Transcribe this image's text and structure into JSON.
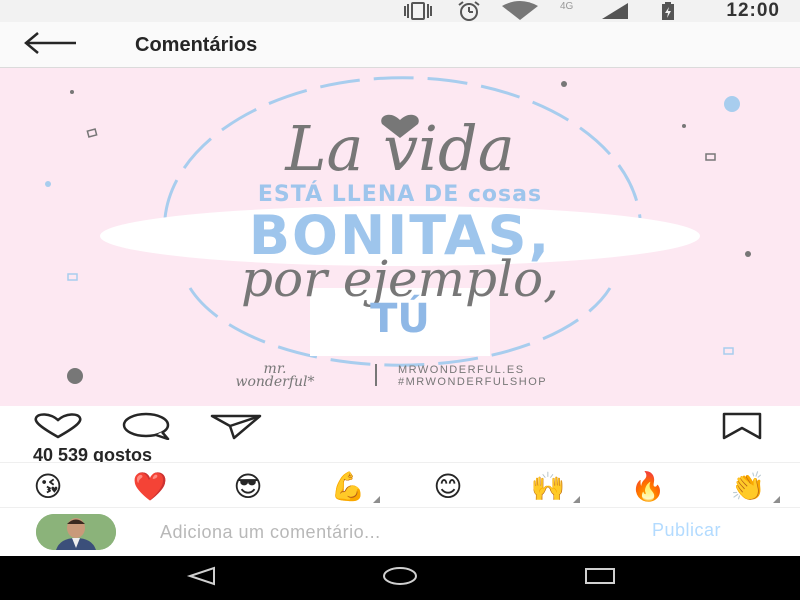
{
  "status_bar": {
    "time": "12:00",
    "network": "4G",
    "icons": [
      "vibrate-icon",
      "alarm-icon",
      "wifi-icon",
      "signal-icon",
      "battery-icon"
    ]
  },
  "header": {
    "title": "Comentários",
    "back_icon": "arrow-left-icon"
  },
  "post": {
    "image_text": {
      "line1": "La vida",
      "line2": "ESTÁ LLENA DE cosas",
      "line3": "BONITAS,",
      "line4": "por ejemplo,",
      "line5": "TÚ",
      "brand_top": "mr.",
      "brand_bottom": "wonderful*",
      "site": "MRWONDERFUL.ES",
      "hashtag": "#MRWONDERFULSHOP"
    },
    "colors": {
      "background": "#fde8f2",
      "grey_text": "#777777",
      "blue_text": "#9ec5ec"
    },
    "actions": {
      "like_icon": "heart-icon",
      "comment_icon": "comment-bubble-icon",
      "share_icon": "paper-plane-icon",
      "save_icon": "bookmark-icon"
    },
    "likes": "40 539 gostos"
  },
  "emoji_bar": {
    "items": [
      "😘",
      "❤️",
      "😎",
      "💪",
      "😊",
      "🙌",
      "🔥",
      "👏"
    ]
  },
  "composer": {
    "placeholder": "Adiciona um comentário...",
    "value": "",
    "publish_label": "Publicar",
    "publish_color": "#b3dbff"
  },
  "nav_bar": {
    "icons": [
      "back-triangle-icon",
      "home-circle-icon",
      "recents-square-icon"
    ]
  }
}
